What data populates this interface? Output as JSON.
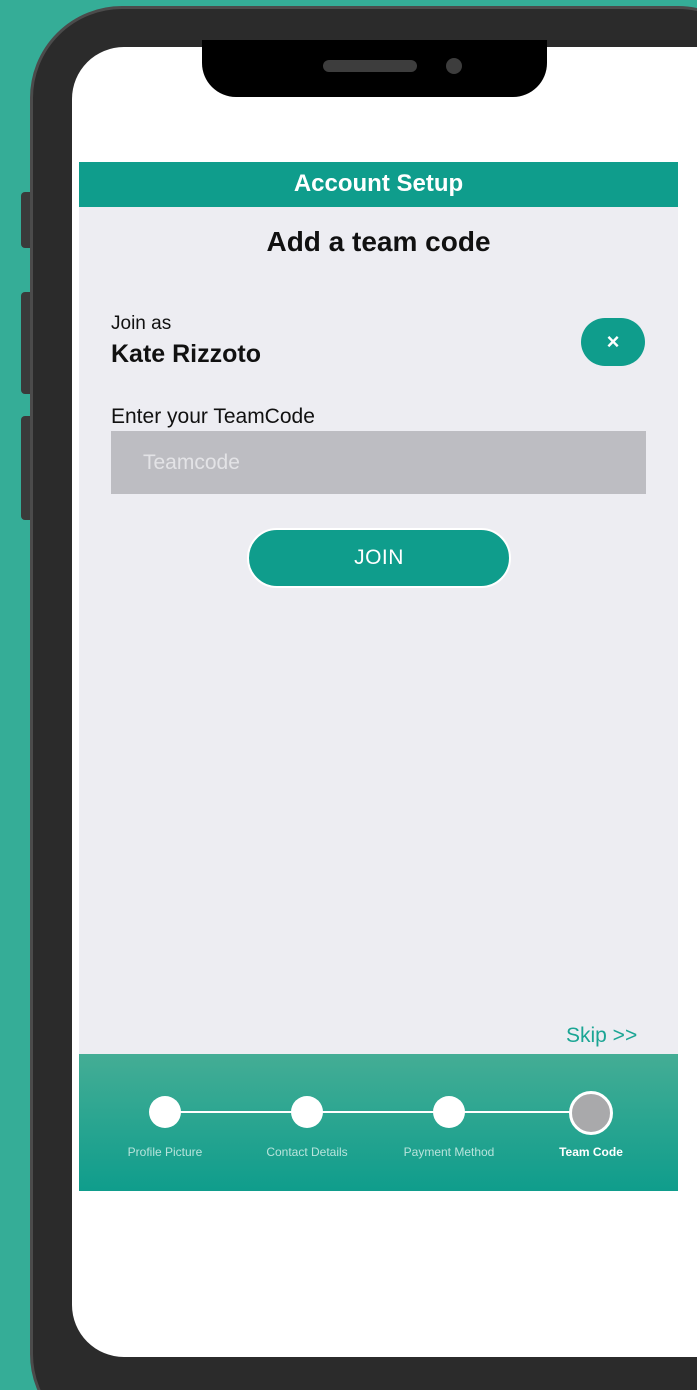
{
  "header": {
    "title": "Account Setup"
  },
  "page": {
    "title": "Add a team code"
  },
  "join": {
    "prefix": "Join as",
    "name": "Kate Rizzoto",
    "close_symbol": "×"
  },
  "teamcode": {
    "label": "Enter your TeamCode",
    "placeholder": "Teamcode",
    "value": ""
  },
  "actions": {
    "join_label": "JOIN",
    "skip_label": "Skip >>"
  },
  "steps": [
    {
      "label": "Profile Picture",
      "active": false
    },
    {
      "label": "Contact Details",
      "active": false
    },
    {
      "label": "Payment Method",
      "active": false
    },
    {
      "label": "Team Code",
      "active": true
    }
  ],
  "colors": {
    "background": "#35ad97",
    "accent": "#0f9d8c",
    "content_bg": "#ededf2",
    "input_bg": "#bdbdc2",
    "link": "#1ba594"
  },
  "icons": {
    "close": "close-icon"
  }
}
